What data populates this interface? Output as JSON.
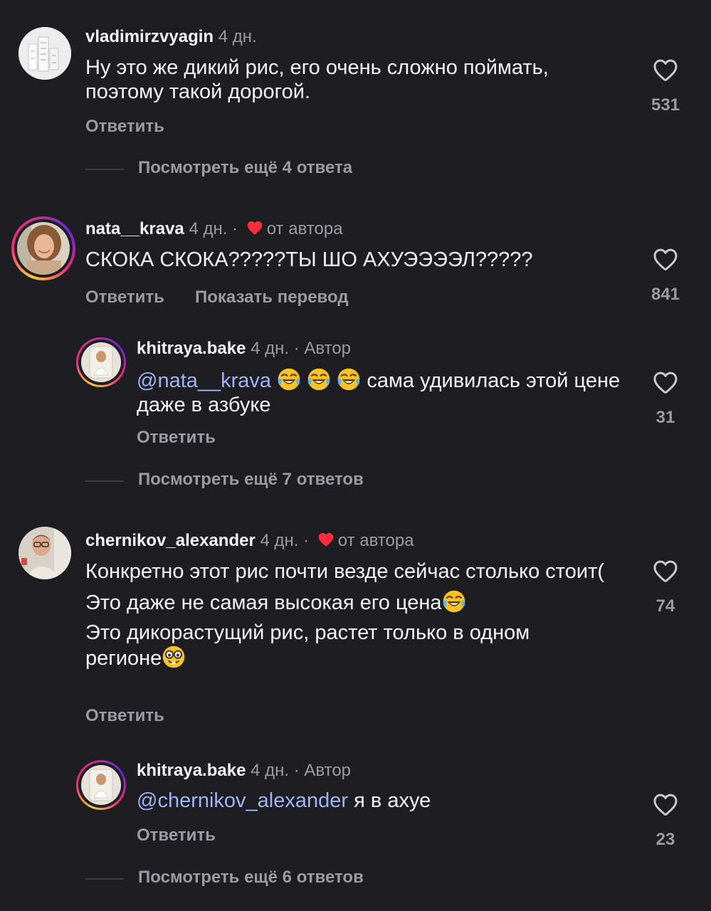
{
  "comments": [
    {
      "username": "vladimirzvyagin",
      "time": "4 дн.",
      "lines": [
        "Ну это же дикий рис, его очень сложно поймать, поэтому такой дорогой."
      ],
      "reply_label": "Ответить",
      "likes": "531",
      "more_label": "Посмотреть ещё 4 ответа"
    },
    {
      "username": "nata__krava",
      "time": "4 дн. ·",
      "author_liked": "от автора",
      "text": "СКОКА СКОКА?????ТЫ ШО АХУЭЭЭЭЛ?????",
      "reply_label": "Ответить",
      "translate_label": "Показать перевод",
      "likes": "841",
      "reply": {
        "username": "khitraya.bake",
        "time": "4 дн. · Автор",
        "mention": "@nata__krava",
        "text": "сама удивилась этой цене даже в азбуке",
        "reply_label": "Ответить",
        "likes": "31"
      },
      "more_label": "Посмотреть ещё 7 ответов"
    },
    {
      "username": "chernikov_alexander",
      "time": "4 дн. ·",
      "author_liked": "от автора",
      "lines": [
        "Конкретно этот рис почти везде сейчас столько стоит(",
        "Это даже не самая высокая его цена",
        "Это дикорастущий рис, растет только в одном регионе"
      ],
      "reply_label": "Ответить",
      "likes": "74",
      "reply": {
        "username": "khitraya.bake",
        "time": "4 дн. · Автор",
        "mention": "@chernikov_alexander",
        "text": "я в ахуе",
        "reply_label": "Ответить",
        "likes": "23"
      },
      "more_label": "Посмотреть ещё 6 ответов"
    }
  ],
  "icons": {
    "like": "heart-outline-icon",
    "author_like": "heart-filled-icon",
    "laugh": "face-with-tears-of-joy-emoji",
    "nerd": "nerd-face-emoji"
  },
  "colors": {
    "background": "#1d1d22",
    "text": "#f4f4f5",
    "muted": "#9b9ba2",
    "mention": "#9fb4f5",
    "author_heart": "#ff2d3c"
  }
}
